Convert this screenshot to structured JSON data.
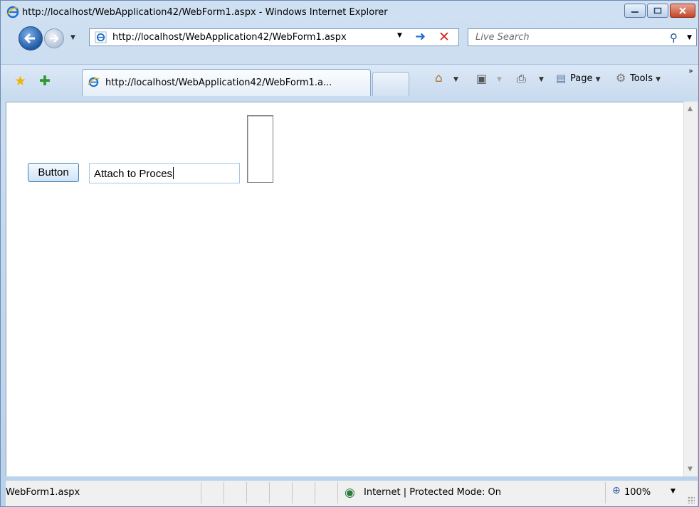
{
  "window": {
    "title": "http://localhost/WebApplication42/WebForm1.aspx - Windows Internet Explorer"
  },
  "address_bar": {
    "url": "http://localhost/WebApplication42/WebForm1.aspx"
  },
  "search": {
    "placeholder": "Live Search"
  },
  "tabs": [
    {
      "label": "http://localhost/WebApplication42/WebForm1.a..."
    }
  ],
  "command_bar": {
    "page_label": "Page",
    "tools_label": "Tools"
  },
  "page": {
    "button_label": "Button",
    "textbox_value": "Attach to Proces"
  },
  "status_bar": {
    "text": "WebForm1.aspx",
    "zone": "Internet | Protected Mode: On",
    "zoom": "100%"
  },
  "icons": [
    "ie-logo-icon",
    "back-icon",
    "forward-icon",
    "refresh-go-icon",
    "stop-icon",
    "search-icon",
    "favorites-star-icon",
    "add-favorite-icon",
    "home-icon",
    "feeds-icon",
    "print-icon",
    "page-icon",
    "tools-gear-icon",
    "globe-icon",
    "zoom-icon"
  ]
}
